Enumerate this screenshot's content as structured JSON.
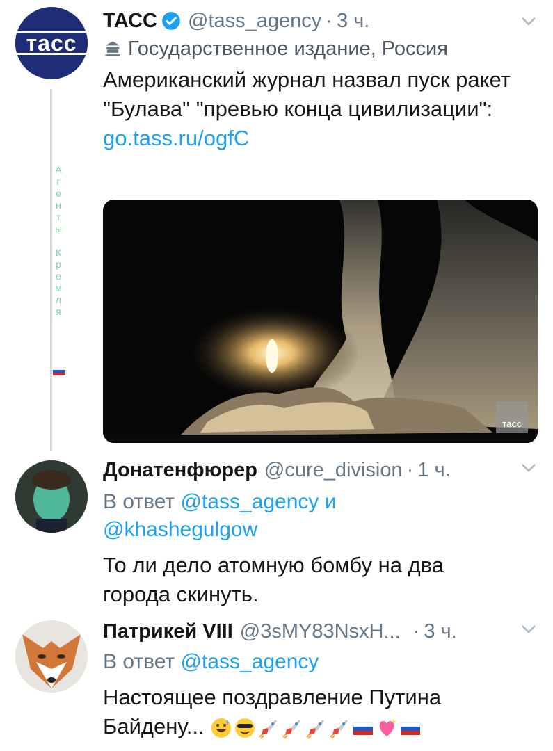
{
  "tweets": [
    {
      "name": "ТАСС",
      "handle": "@tass_agency",
      "time": "3 ч.",
      "label": "Государственное издание, Россия",
      "text": "Американский журнал назвал пуск ракет \"Булава\" \"превью конца цивилизации\":",
      "link": "go.tass.ru/ogfC",
      "avatar_text": "тасс",
      "media_badge": "тасс",
      "side_text": "Агенты Кремля"
    },
    {
      "name": "Донатенфюрер",
      "handle": "@cure_division",
      "time": "1 ч.",
      "reply_prefix": "В ответ",
      "reply_mention_1": "@tass_agency",
      "reply_and": "и",
      "reply_mention_2": "@khashegulgow",
      "text": "То ли дело атомную бомбу на два города скинуть."
    },
    {
      "name": "Патрикей VIII",
      "handle": "@3sMY83NsxH...",
      "time": "3 ч.",
      "reply_prefix": "В ответ",
      "reply_mention_1": "@tass_agency",
      "text": "Настоящее поздравление Путина Байдену...",
      "emojis": [
        "grinning-sweat",
        "sunglasses",
        "rocket",
        "rocket",
        "rocket",
        "rocket",
        "russia-flag",
        "sparkling-heart",
        "russia-flag"
      ]
    }
  ],
  "colors": {
    "link": "#1da1f2",
    "muted": "#657786",
    "verified": "#1da1f2",
    "tass_blue": "#1f2d78"
  }
}
